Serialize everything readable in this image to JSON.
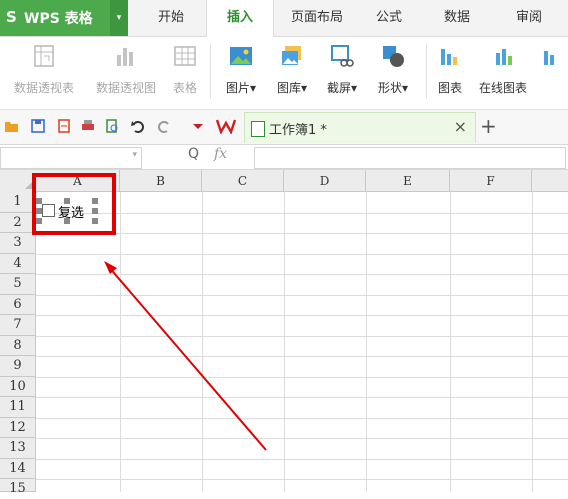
{
  "app": {
    "logo": "S",
    "name": "WPS 表格",
    "dropdown": "▾"
  },
  "tabs": [
    {
      "label": "开始",
      "active": false
    },
    {
      "label": "插入",
      "active": true
    },
    {
      "label": "页面布局",
      "active": false
    },
    {
      "label": "公式",
      "active": false
    },
    {
      "label": "数据",
      "active": false
    },
    {
      "label": "审阅",
      "active": false
    }
  ],
  "ribbon": {
    "pivot_table": {
      "label": "数据透视表",
      "icon": "pivot-table-icon"
    },
    "pivot_chart": {
      "label": "数据透视图",
      "icon": "pivot-chart-icon"
    },
    "table": {
      "label": "表格",
      "icon": "table-icon"
    },
    "picture": {
      "label": "图片",
      "arrow": "▾",
      "icon": "picture-icon"
    },
    "gallery": {
      "label": "图库",
      "arrow": "▾",
      "icon": "gallery-icon"
    },
    "screenshot": {
      "label": "截屏",
      "arrow": "▾",
      "icon": "screenshot-icon"
    },
    "shapes": {
      "label": "形状",
      "arrow": "▾",
      "icon": "shapes-icon"
    },
    "chart": {
      "label": "图表",
      "icon": "chart-icon"
    },
    "online_chart": {
      "label": "在线图表",
      "icon": "online-chart-icon"
    }
  },
  "document_tab": {
    "title": "工作簿1 *",
    "close": "×",
    "add": "+"
  },
  "formula_bar": {
    "zoom_icon": "Q",
    "fx": "fx",
    "value": ""
  },
  "sheet": {
    "columns": [
      "A",
      "B",
      "C",
      "D",
      "E",
      "F"
    ],
    "rows": [
      "1",
      "2",
      "3",
      "4",
      "5",
      "6",
      "7",
      "8",
      "9",
      "10",
      "11",
      "12",
      "13",
      "14",
      "15"
    ]
  },
  "checkbox_control": {
    "label": "复选"
  },
  "annotation": {
    "highlight_color": "#e00000",
    "arrow_color": "#e00000"
  },
  "colors": {
    "brand": "#4ca94c",
    "active_tab_text": "#2f8f2f"
  }
}
